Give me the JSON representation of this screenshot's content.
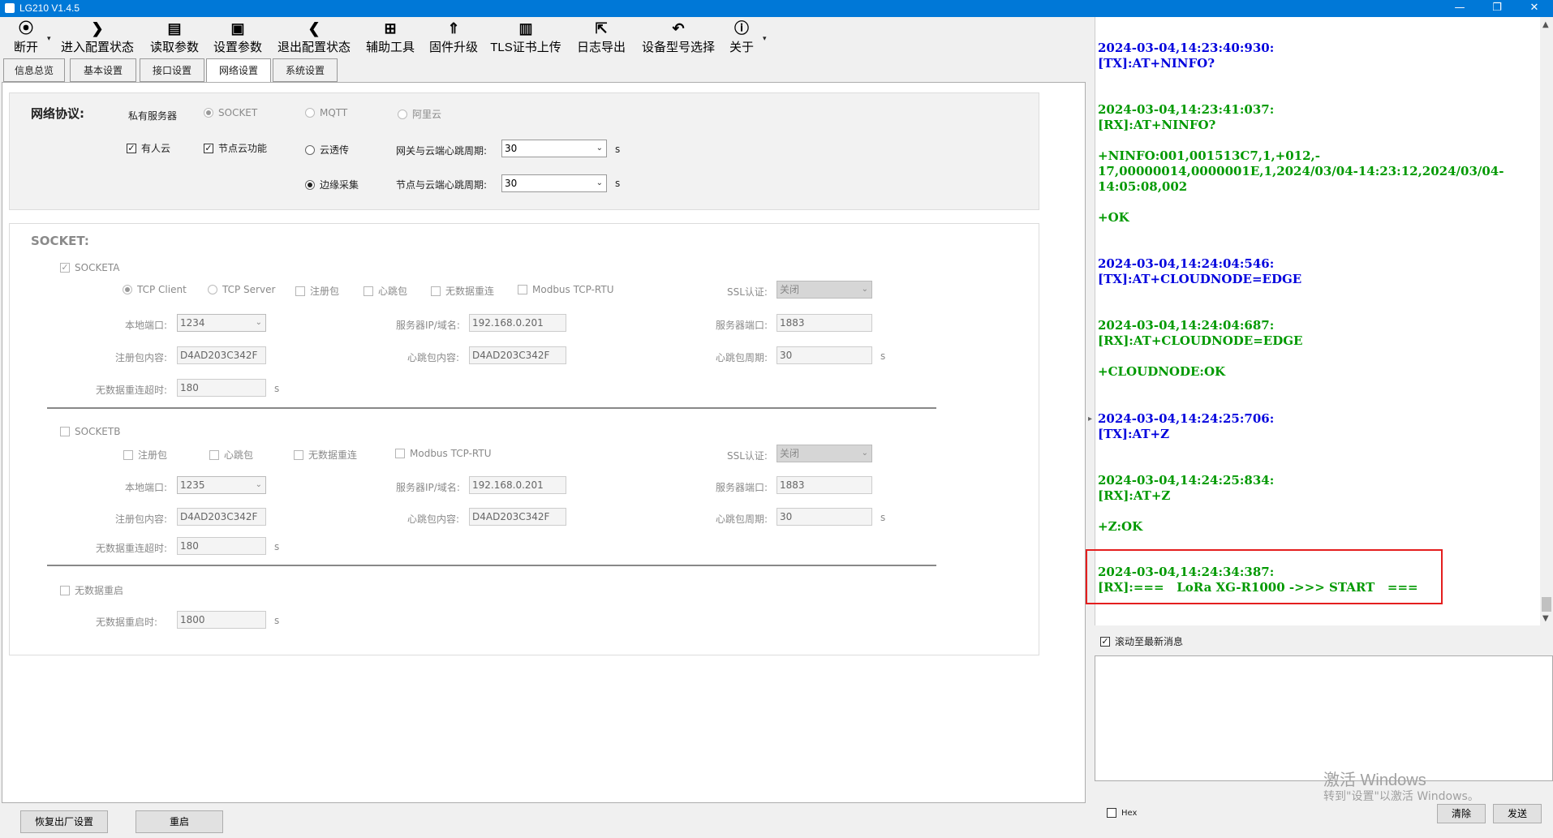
{
  "window": {
    "title": "LG210 V1.4.5",
    "controls": [
      "—",
      "❐",
      "✕"
    ]
  },
  "toolbar": [
    {
      "label": "断开",
      "icon": "⦿",
      "dropdown": true
    },
    {
      "label": "进入配置状态",
      "icon": "❯"
    },
    {
      "label": "读取参数",
      "icon": "▤"
    },
    {
      "label": "设置参数",
      "icon": "▣"
    },
    {
      "label": "退出配置状态",
      "icon": "❮"
    },
    {
      "label": "辅助工具",
      "icon": "⊞"
    },
    {
      "label": "固件升级",
      "icon": "⇑"
    },
    {
      "label": "TLS证书上传",
      "icon": "▥"
    },
    {
      "label": "日志导出",
      "icon": "⇱"
    },
    {
      "label": "设备型号选择",
      "icon": "↶"
    },
    {
      "label": "关于",
      "icon": "ⓘ",
      "dropdown": true
    }
  ],
  "tabs": [
    "信息总览",
    "基本设置",
    "接口设置",
    "网络设置",
    "系统设置"
  ],
  "active_tab": "网络设置",
  "network": {
    "title": "网络协议:",
    "private_server": "私有服务器",
    "socket": "SOCKET",
    "mqtt": "MQTT",
    "aliyun": "阿里云",
    "youren_cloud": "有人云",
    "node_cloud": "节点云功能",
    "cloud_transparent": "云透传",
    "edge_collect": "边缘采集",
    "gateway_heartbeat_label": "网关与云端心跳周期:",
    "gateway_heartbeat_value": "30",
    "node_heartbeat_label": "节点与云端心跳周期:",
    "node_heartbeat_value": "30",
    "unit_s": "s"
  },
  "socket": {
    "title": "SOCKET:",
    "socketa": {
      "label": "SOCKETA",
      "tcp_client": "TCP Client",
      "tcp_server": "TCP Server",
      "register_pkt": "注册包",
      "heartbeat_pkt": "心跳包",
      "no_data_reconnect": "无数据重连",
      "modbus": "Modbus TCP-RTU",
      "ssl_label": "SSL认证:",
      "ssl_value": "关闭",
      "local_port_label": "本地端口:",
      "local_port": "1234",
      "server_ip_label": "服务器IP/域名:",
      "server_ip": "192.168.0.201",
      "server_port_label": "服务器端口:",
      "server_port": "1883",
      "register_content_label": "注册包内容:",
      "register_content": "D4AD203C342F",
      "heartbeat_content_label": "心跳包内容:",
      "heartbeat_content": "D4AD203C342F",
      "heartbeat_period_label": "心跳包周期:",
      "heartbeat_period": "30",
      "reconnect_timeout_label": "无数据重连超时:",
      "reconnect_timeout": "180",
      "unit_s": "s"
    },
    "socketb": {
      "label": "SOCKETB",
      "register_pkt": "注册包",
      "heartbeat_pkt": "心跳包",
      "no_data_reconnect": "无数据重连",
      "modbus": "Modbus TCP-RTU",
      "ssl_label": "SSL认证:",
      "ssl_value": "关闭",
      "local_port_label": "本地端口:",
      "local_port": "1235",
      "server_ip_label": "服务器IP/域名:",
      "server_ip": "192.168.0.201",
      "server_port_label": "服务器端口:",
      "server_port": "1883",
      "register_content_label": "注册包内容:",
      "register_content": "D4AD203C342F",
      "heartbeat_content_label": "心跳包内容:",
      "heartbeat_content": "D4AD203C342F",
      "heartbeat_period_label": "心跳包周期:",
      "heartbeat_period": "30",
      "reconnect_timeout_label": "无数据重连超时:",
      "reconnect_timeout": "180",
      "unit_s": "s"
    },
    "no_data_restart": "无数据重启",
    "restart_timeout_label": "无数据重启时:",
    "restart_timeout": "1800",
    "unit_s": "s"
  },
  "buttons": {
    "factory_reset": "恢复出厂设置",
    "restart": "重启"
  },
  "log": [
    {
      "type": "tx",
      "text": "2024-03-04,14:23:40:930:\n[TX]:AT+NINFO?"
    },
    {
      "type": "rx",
      "text": "2024-03-04,14:23:41:037:\n[RX]:AT+NINFO?\n\n+NINFO:001,001513C7,1,+012,-\n17,00000014,0000001E,1,2024/03/04-14:23:12,2024/03/04-\n14:05:08,002\n\n+OK"
    },
    {
      "type": "tx",
      "text": "2024-03-04,14:24:04:546:\n[TX]:AT+CLOUDNODE=EDGE"
    },
    {
      "type": "rx",
      "text": "2024-03-04,14:24:04:687:\n[RX]:AT+CLOUDNODE=EDGE\n\n+CLOUDNODE:OK"
    },
    {
      "type": "tx",
      "text": "2024-03-04,14:24:25:706:\n[TX]:AT+Z"
    },
    {
      "type": "rx",
      "text": "2024-03-04,14:24:25:834:\n[RX]:AT+Z\n\n+Z:OK"
    },
    {
      "type": "rx",
      "text": "2024-03-04,14:24:34:387:\n[RX]:===   LoRa XG-R1000 ->>> START   ==="
    }
  ],
  "scroll_latest": "滚动至最新消息",
  "hex": "Hex",
  "clear": "清除",
  "send": "发送",
  "watermark": {
    "line1": "激活 Windows",
    "line2": "转到\"设置\"以激活 Windows。"
  }
}
